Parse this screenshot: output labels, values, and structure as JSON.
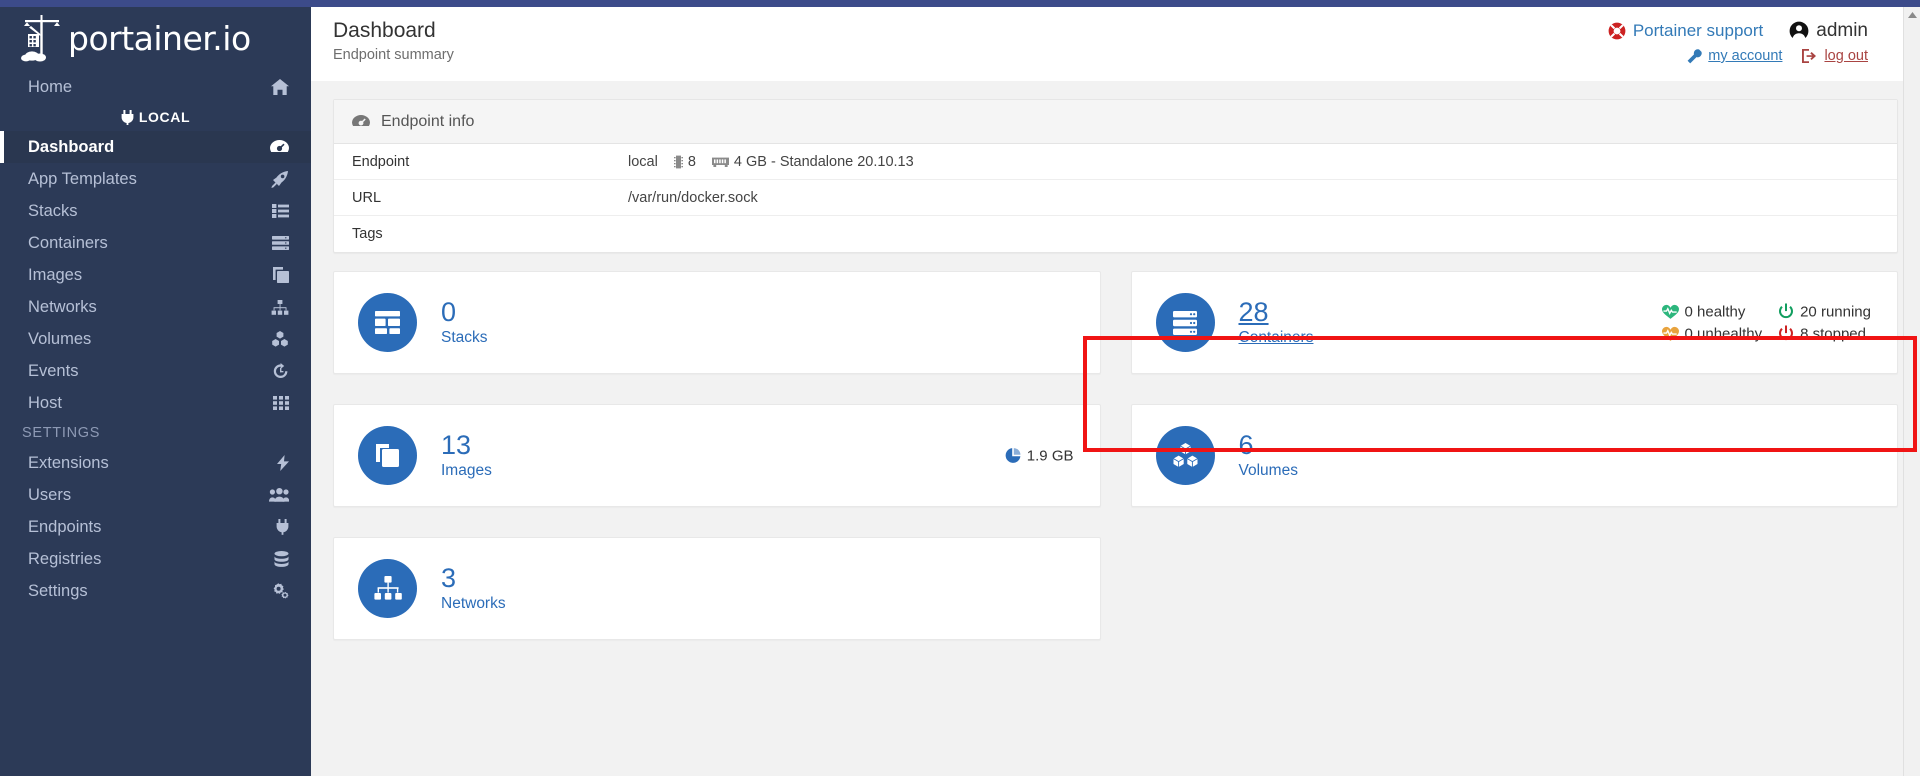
{
  "brand": {
    "name": "portainer.io",
    "logo_icon": "portainer-crane-logo",
    "shuffle_icon": "endpoint-switch-icon"
  },
  "colors": {
    "sidebar_bg": "#2c3a57",
    "topbar": "#3c4b8a",
    "accent_blue": "#2b6cb8",
    "link_blue": "#337ab7",
    "link_red": "#a94442",
    "highlight": "#f01414",
    "healthy_green": "#2cb67d",
    "unhealthy_orange": "#e8a33d",
    "running_green": "#119e5f",
    "stopped_red": "#cc2222"
  },
  "sidebar": {
    "home": {
      "label": "Home",
      "icon": "home-icon"
    },
    "environment": {
      "label": "LOCAL",
      "icon": "plug-icon"
    },
    "items": [
      {
        "label": "Dashboard",
        "icon": "dashboard-gauge-icon",
        "active": true
      },
      {
        "label": "App Templates",
        "icon": "rocket-icon",
        "active": false
      },
      {
        "label": "Stacks",
        "icon": "list-icon",
        "active": false
      },
      {
        "label": "Containers",
        "icon": "server-stack-icon",
        "active": false
      },
      {
        "label": "Images",
        "icon": "copy-layers-icon",
        "active": false
      },
      {
        "label": "Networks",
        "icon": "sitemap-icon",
        "active": false
      },
      {
        "label": "Volumes",
        "icon": "cubes-icon",
        "active": false
      },
      {
        "label": "Events",
        "icon": "history-clock-icon",
        "active": false
      },
      {
        "label": "Host",
        "icon": "grid-th-icon",
        "active": false
      }
    ],
    "settings_heading": "SETTINGS",
    "settings_items": [
      {
        "label": "Extensions",
        "icon": "bolt-icon"
      },
      {
        "label": "Users",
        "icon": "users-icon"
      },
      {
        "label": "Endpoints",
        "icon": "plug-icon"
      },
      {
        "label": "Registries",
        "icon": "database-icon"
      },
      {
        "label": "Settings",
        "icon": "cogs-icon"
      }
    ]
  },
  "header": {
    "title": "Dashboard",
    "subtitle": "Endpoint summary",
    "support_label": "Portainer support",
    "support_icon": "life-ring-icon",
    "user_name": "admin",
    "user_icon": "user-circle-icon",
    "my_account_label": "my account",
    "my_account_icon": "wrench-icon",
    "logout_label": "log out",
    "logout_icon": "sign-out-icon"
  },
  "endpoint_info": {
    "panel_title": "Endpoint info",
    "panel_icon": "tachometer-icon",
    "rows": [
      {
        "key": "Endpoint",
        "value": "local",
        "cpu_icon": "microchip-icon",
        "cpu": "8",
        "memory_icon": "memory-icon",
        "memory": "4 GB - Standalone 20.10.13"
      },
      {
        "key": "URL",
        "value": "/var/run/docker.sock"
      },
      {
        "key": "Tags",
        "value": ""
      }
    ]
  },
  "widgets": {
    "stacks": {
      "count": "0",
      "label": "Stacks",
      "icon": "stacks-grid-icon"
    },
    "images": {
      "count": "13",
      "label": "Images",
      "icon": "images-layers-icon",
      "size_icon": "pie-chart-icon",
      "size": "1.9 GB"
    },
    "networks": {
      "count": "3",
      "label": "Networks",
      "icon": "sitemap-icon"
    },
    "containers": {
      "count": "28",
      "label": "Containers",
      "icon": "server-stack-icon",
      "statuses": [
        {
          "label": "0 healthy",
          "icon": "heartbeat-green-icon"
        },
        {
          "label": "20 running",
          "icon": "power-green-icon"
        },
        {
          "label": "0 unhealthy",
          "icon": "heartbeat-orange-icon"
        },
        {
          "label": "8 stopped",
          "icon": "power-red-icon"
        }
      ]
    },
    "volumes": {
      "count": "6",
      "label": "Volumes",
      "icon": "cubes-icon"
    }
  },
  "scrollbar": {
    "up_arrow_icon": "scroll-up-arrow-icon"
  }
}
